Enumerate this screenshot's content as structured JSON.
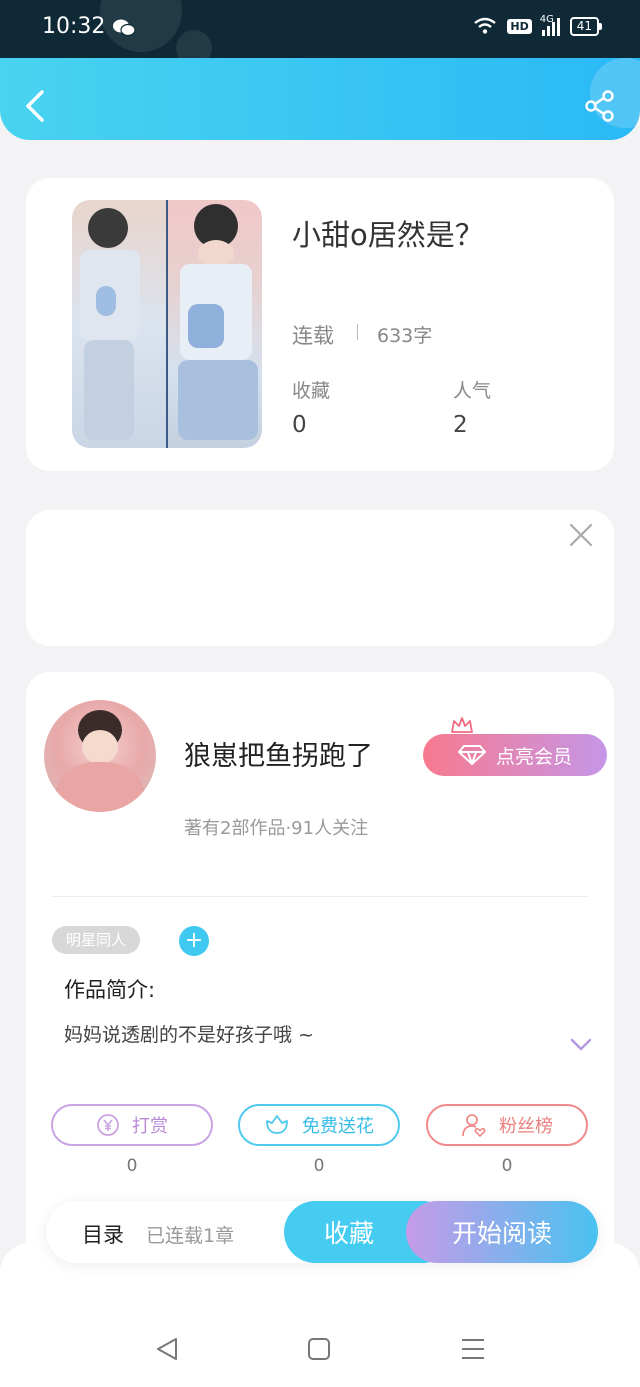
{
  "status_bar": {
    "time": "10:32",
    "network": "4G",
    "hd": "HD",
    "battery": "41"
  },
  "header": {
    "back_icon": "chevron-left-icon",
    "share_icon": "share-icon"
  },
  "book": {
    "title": "小甜o居然是？",
    "status": "连载",
    "word_count": "633字",
    "stats": [
      {
        "label": "收藏",
        "value": "0"
      },
      {
        "label": "人气",
        "value": "2"
      }
    ]
  },
  "author": {
    "name": "狼崽把鱼拐跑了",
    "meta": "著有2部作品·91人关注",
    "vip_label": "点亮会员"
  },
  "tag": {
    "label": "明星同人",
    "add_label": "+"
  },
  "intro": {
    "title": "作品简介:",
    "text": "妈妈说透剧的不是好孩子哦 ~"
  },
  "actions": [
    {
      "label": "打赏",
      "count": "0",
      "icon": "yen-icon"
    },
    {
      "label": "免费送花",
      "count": "0",
      "icon": "flower-icon"
    },
    {
      "label": "粉丝榜",
      "count": "0",
      "icon": "user-heart-icon"
    }
  ],
  "bottom_bar": {
    "toc_label": "目录",
    "chapters": "已连载1章",
    "collect_label": "收藏",
    "read_label": "开始阅读"
  },
  "colors": {
    "header": "#2ab9f5",
    "accent": "#45ccf0",
    "vip": "#f77a8e"
  }
}
